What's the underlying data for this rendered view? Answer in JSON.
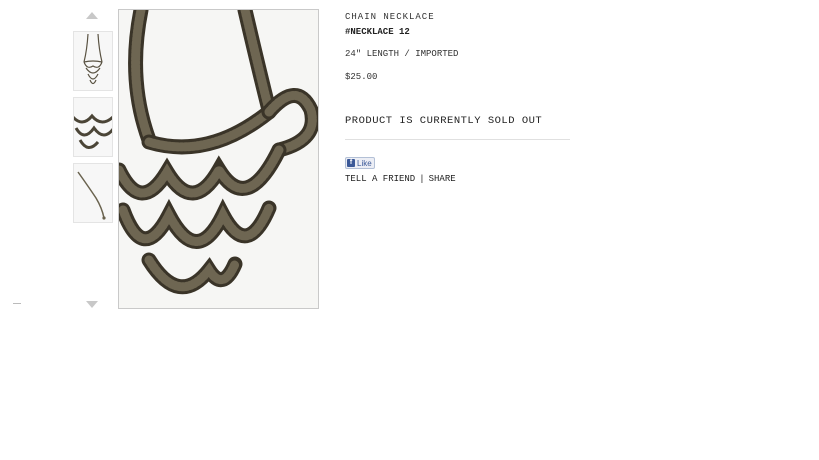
{
  "product": {
    "name": "CHAIN NECKLACE",
    "sku": "#NECKLACE 12",
    "spec": "24\" LENGTH / IMPORTED",
    "price": "$25.00",
    "status": "PRODUCT IS CURRENTLY SOLD OUT"
  },
  "social": {
    "like_label": "Like",
    "fb_glyph": "f",
    "tell_a_friend": "TELL A FRIEND",
    "separator": "|",
    "share": "SHARE"
  },
  "thumbnails": {
    "count": 3,
    "up_arrow_icon": "triangle-up-icon",
    "down_arrow_icon": "triangle-down-icon"
  },
  "colors": {
    "chain": "#5a5343",
    "chain_dark": "#3a3428",
    "image_bg": "#f6f6f4",
    "facebook_blue": "#3b5998"
  }
}
